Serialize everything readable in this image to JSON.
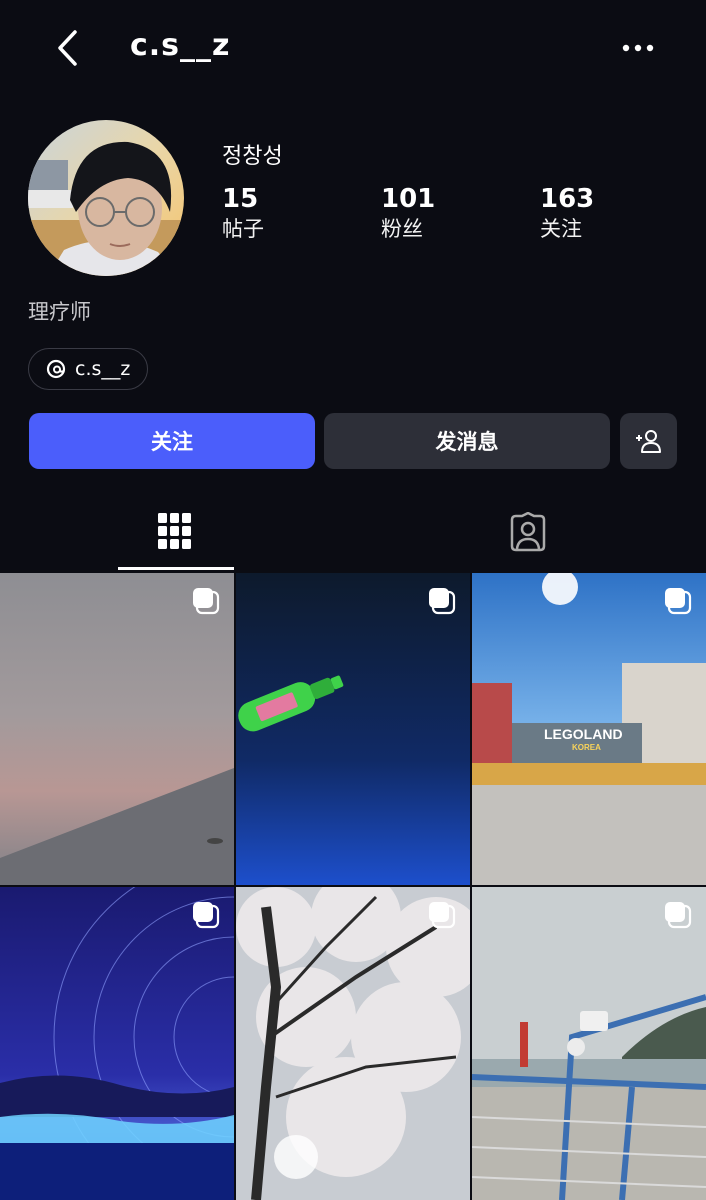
{
  "header": {
    "username": "c.s__z",
    "back_icon": "chevron-left-icon",
    "more_icon": "more-horizontal-icon"
  },
  "profile": {
    "display_name": "정창성",
    "stats": [
      {
        "value": "15",
        "label": "帖子"
      },
      {
        "value": "101",
        "label": "粉丝"
      },
      {
        "value": "163",
        "label": "关注"
      }
    ],
    "bio": "理疗师",
    "threads_handle": "c.s__z"
  },
  "actions": {
    "follow_label": "关注",
    "message_label": "发消息",
    "follow_color": "#4b5efb",
    "secondary_color": "#2d2f38"
  },
  "tabs": [
    {
      "icon": "grid-icon",
      "selected": true
    },
    {
      "icon": "tagged-person-icon",
      "selected": false
    }
  ],
  "posts": [
    {
      "description": "hazy pink sky over water",
      "multi": true
    },
    {
      "description": "glowing bottle drone show",
      "multi": true
    },
    {
      "description": "LEGOLAND Korea entrance",
      "multi": true,
      "sign_text": "LEGOLAND",
      "sign_subtext": "KOREA"
    },
    {
      "description": "starry blue night sky",
      "multi": true
    },
    {
      "description": "cherry blossom tree",
      "multi": true
    },
    {
      "description": "seaside lighthouse railing",
      "multi": true
    }
  ]
}
